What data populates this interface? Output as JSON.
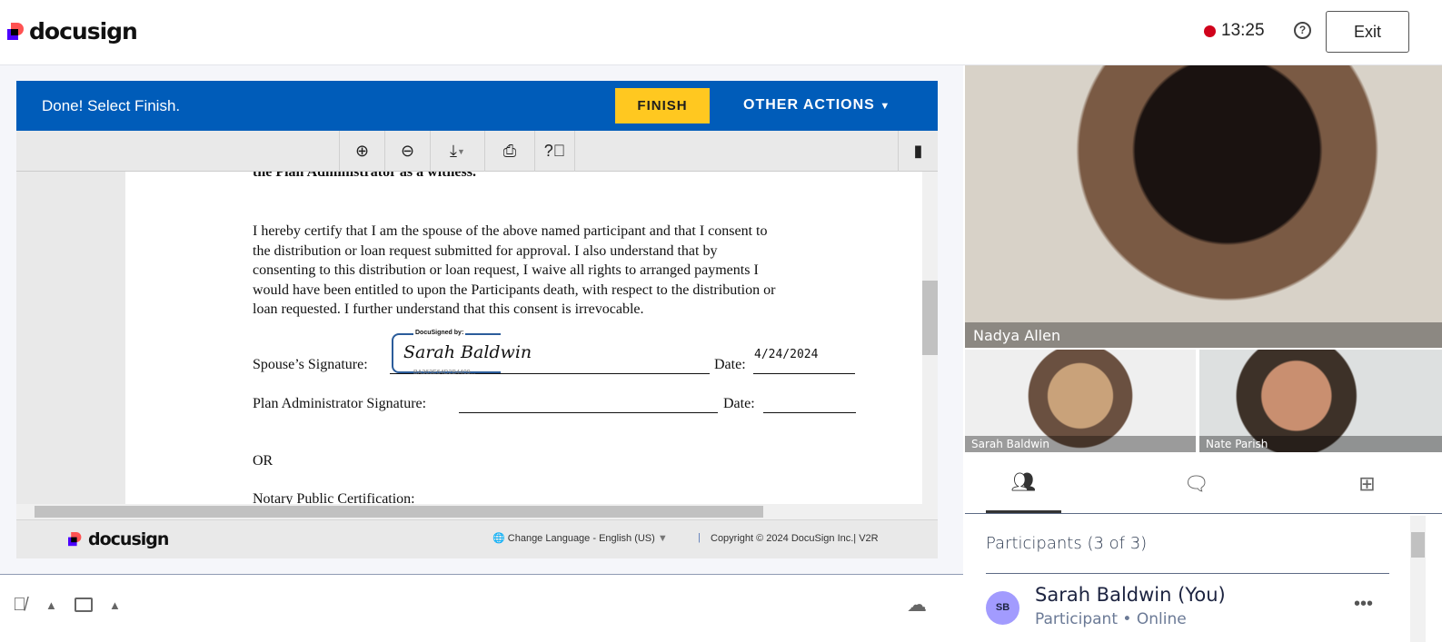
{
  "header": {
    "brand": "docusign",
    "timer": "13:25",
    "help_icon": "help-circle-icon",
    "exit_label": "Exit",
    "recording_color": "#d0021b"
  },
  "banner": {
    "message": "Done! Select Finish.",
    "finish_label": "FINISH",
    "other_actions_label": "OTHER ACTIONS",
    "color": "#005cb9",
    "finish_color": "#ffc820"
  },
  "toolbar": {
    "icons": [
      "zoom-in-icon",
      "zoom-out-icon",
      "download-icon",
      "print-icon",
      "help-icon",
      "document-icon"
    ]
  },
  "document": {
    "cut_heading": "the Plan Administrator as a witness.",
    "paragraph": [
      "I hereby certify that I am the spouse of the above named participant and that I consent to",
      "the distribution or loan request submitted for approval. I also understand that by",
      "consenting to this distribution or loan request, I waive all rights to arranged payments I",
      "would have been entitled to upon the Participants death, with respect to the distribution or",
      "loan requested. I further understand that this consent is irrevocable."
    ],
    "spouse_sig_label": "Spouse’s Signature:",
    "docusigned_by": "DocuSigned by:",
    "signature": "Sarah Baldwin",
    "signature_id": "BA363E64D2B4409...",
    "date_label": "Date:",
    "date_value": "4/24/2024",
    "admin_sig_label": "Plan Administrator Signature:",
    "or": "OR",
    "notary": "Notary Public Certification:"
  },
  "footer": {
    "brand": "docusign",
    "language": "Change Language - English (US)",
    "copyright": "Copyright © 2024 DocuSign Inc.| V2R"
  },
  "controls": {
    "icons": [
      "mic-off-icon",
      "video-icon",
      "upload-cloud-icon"
    ]
  },
  "video": {
    "main_name": "Nadya Allen",
    "thumbs": [
      "Sarah Baldwin",
      "Nate Parish"
    ]
  },
  "panel": {
    "tabs": [
      "participants-tab",
      "chat-tab",
      "apps-tab"
    ],
    "participants_title": "Participants (3 of 3)",
    "participants": [
      {
        "initials": "SB",
        "name": "Sarah Baldwin (You)",
        "status": "Participant • Online",
        "avatar_color": "#a29bfe"
      }
    ]
  }
}
